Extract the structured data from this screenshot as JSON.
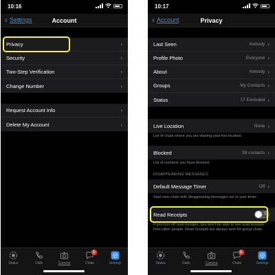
{
  "left": {
    "status_time": "10:16",
    "back_label": "Settings",
    "title": "Account",
    "group1": [
      {
        "label": "Privacy"
      },
      {
        "label": "Security"
      },
      {
        "label": "Two-Step Verification"
      },
      {
        "label": "Change Number"
      }
    ],
    "group2": [
      {
        "label": "Request Account Info"
      },
      {
        "label": "Delete My Account"
      }
    ]
  },
  "right": {
    "status_time": "10:17",
    "back_label": "Account",
    "title": "Privacy",
    "group1": [
      {
        "label": "Last Seen",
        "value": "Nobody"
      },
      {
        "label": "Profile Photo",
        "value": "Everyone"
      },
      {
        "label": "About",
        "value": "Nobody"
      },
      {
        "label": "Groups",
        "value": "My Contacts"
      },
      {
        "label": "Status",
        "value": "17 Excluded"
      }
    ],
    "live_location": {
      "label": "Live Location",
      "value": "None"
    },
    "live_location_note": "List of chats where you are sharing your live location.",
    "blocked": {
      "label": "Blocked",
      "value": "59 contacts"
    },
    "blocked_note": "List of contacts you have blocked.",
    "disappearing_header": "DISAPPEARING MESSAGES",
    "timer": {
      "label": "Default Message Timer",
      "value": "Off"
    },
    "timer_note": "Start new chats with disappearing messages set to your timer.",
    "read_receipts": {
      "label": "Read Receipts",
      "toggle_glyph": "O",
      "enabled": false
    },
    "read_receipts_note": "If you turn off read receipts, you won't be able to see read receipts from other people. Read receipts are always sent for group chats."
  },
  "tabbar": [
    {
      "label": "Status",
      "icon": "status-icon"
    },
    {
      "label": "Calls",
      "icon": "phone-icon"
    },
    {
      "label": "Camera",
      "icon": "camera-icon"
    },
    {
      "label": "Chats",
      "icon": "chats-icon",
      "badge": "1"
    },
    {
      "label": "Settings",
      "icon": "gear-icon"
    }
  ],
  "colors": {
    "accent": "#3a8ee8",
    "highlight": "#f5f54a",
    "badge": "#ff3b30"
  }
}
